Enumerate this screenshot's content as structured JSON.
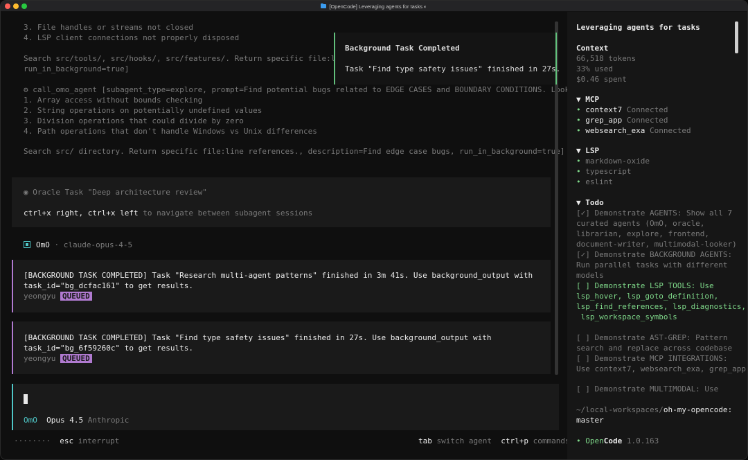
{
  "window": {
    "title": "[OpenCode] Leveraging agents for tasks ◐"
  },
  "transcript": {
    "lines": [
      "3. File handles or streams not closed",
      "4. LSP client connections not properly disposed",
      "Search src/tools/, src/hooks/, src/features/. Return specific file:line",
      "run_in_background=true]",
      "⚙ call_omo_agent [subagent_type=explore, prompt=Find potential bugs related to EDGE CASES and BOUNDARY CONDITIONS. Look for",
      "1. Array access without bounds checking",
      "2. String operations on potentially undefined values",
      "3. Division operations that could divide by zero",
      "4. Path operations that don't handle Windows vs Unix differences",
      "Search src/ directory. Return specific file:line references., description=Find edge case bugs, run_in_background=true]"
    ]
  },
  "toast": {
    "title": "Background Task Completed",
    "message": "Task \"Find type safety issues\" finished in 27s."
  },
  "oracle": {
    "title": "◉ Oracle Task \"Deep architecture review\"",
    "keys": "ctrl+x right, ctrl+x left",
    "hint": " to navigate between subagent sessions"
  },
  "agent_header": {
    "name": "OmO",
    "separator": " · ",
    "model": "claude-opus-4-5"
  },
  "tasks": [
    {
      "line1": "[BACKGROUND TASK COMPLETED] Task \"Research multi-agent patterns\" finished in 3m 41s. Use background_output with",
      "line2": "task_id=\"bg_dcfac161\" to get results.",
      "user": "yeongyu",
      "badge": "QUEUED"
    },
    {
      "line1": "[BACKGROUND TASK COMPLETED] Task \"Find type safety issues\" finished in 27s. Use background_output with",
      "line2": "task_id=\"bg_6f59260c\" to get results.",
      "user": "yeongyu",
      "badge": "QUEUED"
    }
  ],
  "input": {
    "agent": "OmO",
    "model": "Opus 4.5",
    "provider": "Anthropic"
  },
  "footer": {
    "spinner": "········",
    "esc_key": "esc",
    "esc_label": "interrupt",
    "tab_key": "tab",
    "tab_label": "switch agent",
    "cmd_key": "ctrl+p",
    "cmd_label": "commands"
  },
  "sidebar": {
    "title": "Leveraging agents for tasks",
    "context": {
      "heading": "Context",
      "tokens": "66,518 tokens",
      "used": "33% used",
      "spent": "$0.46 spent"
    },
    "mcp": {
      "heading": "▼ MCP",
      "items": [
        {
          "name": "context7",
          "status": "Connected"
        },
        {
          "name": "grep_app",
          "status": "Connected"
        },
        {
          "name": "websearch_exa",
          "status": "Connected"
        }
      ]
    },
    "lsp": {
      "heading": "▼ LSP",
      "items": [
        "markdown-oxide",
        "typescript",
        "eslint"
      ]
    },
    "todo": {
      "heading": "▼ Todo",
      "lines": [
        "[✓] Demonstrate AGENTS: Show all 7",
        "curated agents (OmO, oracle,",
        "librarian, explore, frontend,",
        "document-writer, multimodal-looker)",
        "[✓] Demonstrate BACKGROUND AGENTS:",
        "Run parallel tasks with different",
        "models",
        "[ ] Demonstrate LSP TOOLS: Use",
        "lsp_hover, lsp_goto_definition,",
        "lsp_find_references, lsp_diagnostics,",
        " lsp_workspace_symbols",
        "[ ] Demonstrate AST-GREP: Pattern",
        "search and replace across codebase",
        "[ ] Demonstrate MCP INTEGRATIONS:",
        "Use context7, websearch_exa, grep_app",
        "[ ] Demonstrate MULTIMODAL: Use"
      ]
    },
    "path_prefix": "~/local-workspaces/",
    "path_repo": "oh-my-opencode",
    "path_suffix": ":",
    "branch": "master",
    "app_prefix": "• Open",
    "app_bold": "Code",
    "version": " 1.0.163"
  }
}
